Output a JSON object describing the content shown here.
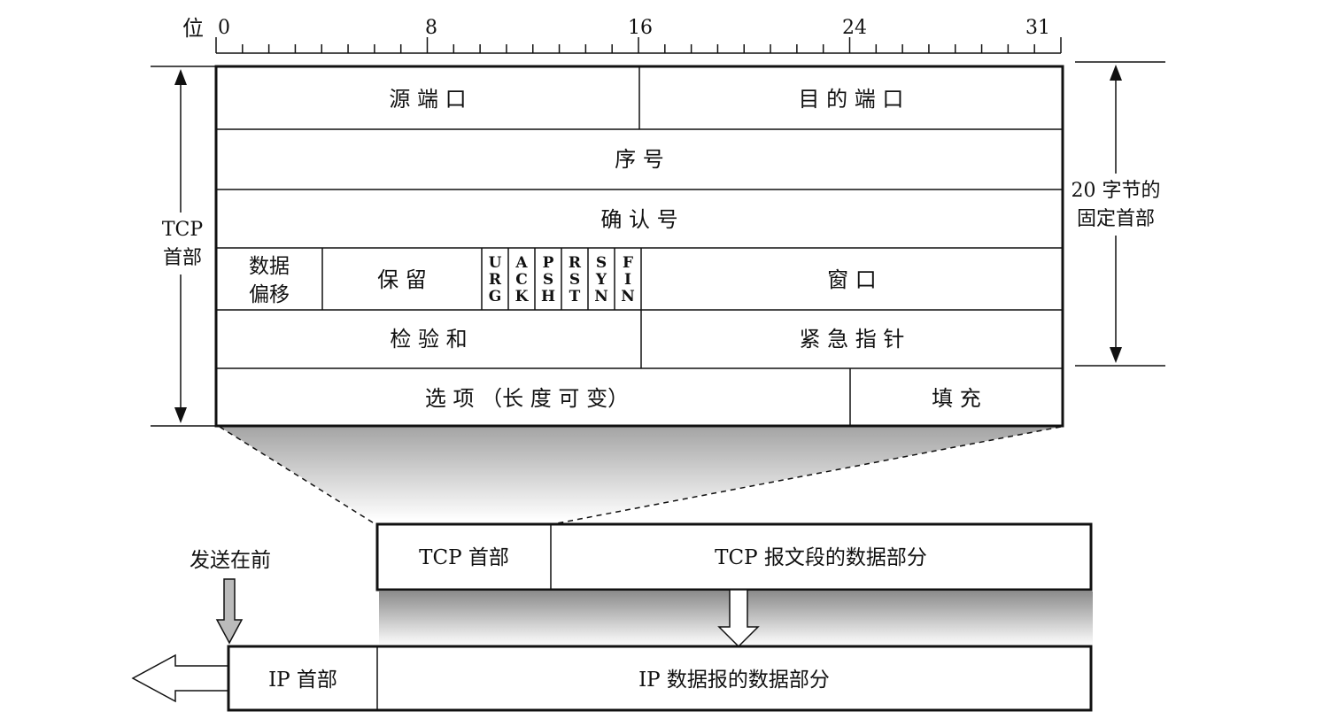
{
  "ruler": {
    "unit_label": "位",
    "ticks": [
      "0",
      "8",
      "16",
      "24",
      "31"
    ]
  },
  "header_rows": {
    "row1": {
      "left": "源 端 口",
      "right": "目 的 端 口"
    },
    "row2": "序 号",
    "row3": "确 认 号",
    "row4": {
      "offset": [
        "数据",
        "偏移"
      ],
      "reserved": "保 留",
      "flags": [
        [
          "U",
          "R",
          "G"
        ],
        [
          "A",
          "C",
          "K"
        ],
        [
          "P",
          "S",
          "H"
        ],
        [
          "R",
          "S",
          "T"
        ],
        [
          "S",
          "Y",
          "N"
        ],
        [
          "F",
          "I",
          "N"
        ]
      ],
      "window": "窗 口"
    },
    "row5": {
      "left": "检 验 和",
      "right": "紧 急 指 针"
    },
    "row6": {
      "left": "选 项 （长 度 可 变）",
      "right": "填 充"
    }
  },
  "left_brace": {
    "line1": "TCP",
    "line2": "首部"
  },
  "right_brace": {
    "line1": "20 字节的",
    "line2": "固定首部"
  },
  "tcp_segment": {
    "header": "TCP 首部",
    "data": "TCP 报文段的数据部分"
  },
  "send_first": "发送在前",
  "ip_datagram": {
    "header": "IP 首部",
    "data": "IP 数据报的数据部分"
  }
}
